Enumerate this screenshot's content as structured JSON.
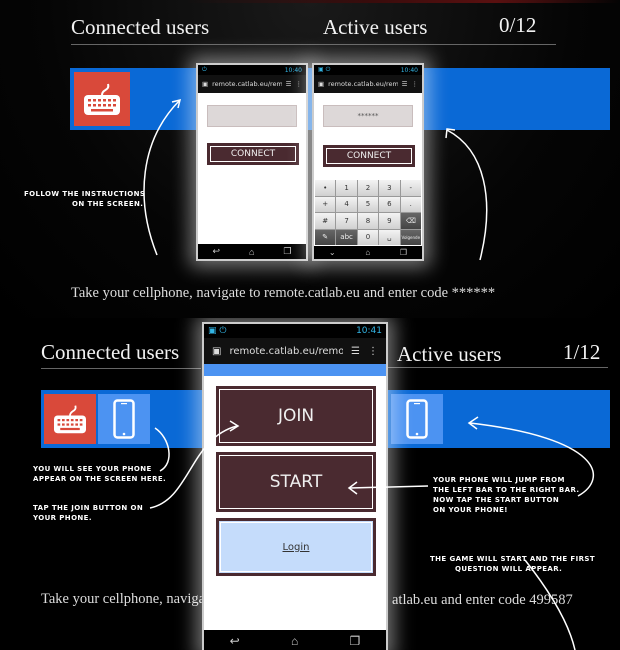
{
  "top_panel": {
    "connected_heading": "Connected users",
    "active_heading": "Active users",
    "active_count": "0/12",
    "annotation": [
      "Follow the instructions",
      "on the screen."
    ],
    "instruction": "Take your cellphone, navigate to remote.catlab.eu and enter code ******",
    "phone_left": {
      "time": "10:40",
      "url": "remote.catlab.eu/rem",
      "code_value": "",
      "connect_label": "CONNECT"
    },
    "phone_right": {
      "time": "10:40",
      "url": "remote.catlab.eu/rem",
      "code_value": "******",
      "connect_label": "CONNECT",
      "keypad": [
        "•",
        "1",
        "2",
        "3",
        "-",
        "+",
        "4",
        "5",
        "6",
        ".",
        "#",
        "7",
        "8",
        "9",
        "⌫",
        "✎",
        "abc",
        "0",
        "␣",
        "Volgende"
      ]
    }
  },
  "bottom_panel": {
    "connected_heading": "Connected users",
    "active_heading": "Active users",
    "active_count": "1/12",
    "annotation_left_1": [
      "You will see your phone",
      "appear on the screen here."
    ],
    "annotation_left_2": [
      "Tap the join button on",
      "your phone."
    ],
    "annotation_right_1": [
      "Your phone will jump from",
      "the left bar to the right bar.",
      "Now tap the start button",
      "on your phone!"
    ],
    "annotation_right_2": [
      "The game will start and the first",
      "question will appear."
    ],
    "instruction_left": "Take your cellphone, navigate",
    "instruction_right": "atlab.eu and enter code 499587",
    "phone": {
      "time": "10:41",
      "url": "remote.catlab.eu/remo",
      "join_label": "JOIN",
      "start_label": "START",
      "login_label": "Login"
    }
  },
  "icons": {
    "connected_tile": "keyboard-icon",
    "device_tile": "smartphone-icon"
  },
  "colors": {
    "bar_blue": "#0a69d6",
    "tile_red": "#d9493a",
    "tile_lightblue": "#4c93f2",
    "button_maroon": "#4a2a30",
    "login_bg": "#c5dcfb",
    "status_blue": "#33b5e5"
  }
}
